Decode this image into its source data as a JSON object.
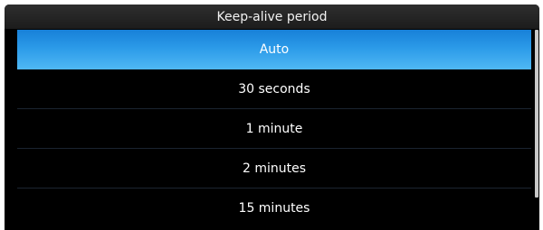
{
  "dialog": {
    "title": "Keep-alive period",
    "options": [
      {
        "label": "Auto",
        "selected": true
      },
      {
        "label": "30 seconds",
        "selected": false
      },
      {
        "label": "1 minute",
        "selected": false
      },
      {
        "label": "2 minutes",
        "selected": false
      },
      {
        "label": "15 minutes",
        "selected": false
      }
    ]
  },
  "colors": {
    "selected_highlight": "#2b9ae8",
    "background": "#000000",
    "separator": "#1b2430"
  }
}
